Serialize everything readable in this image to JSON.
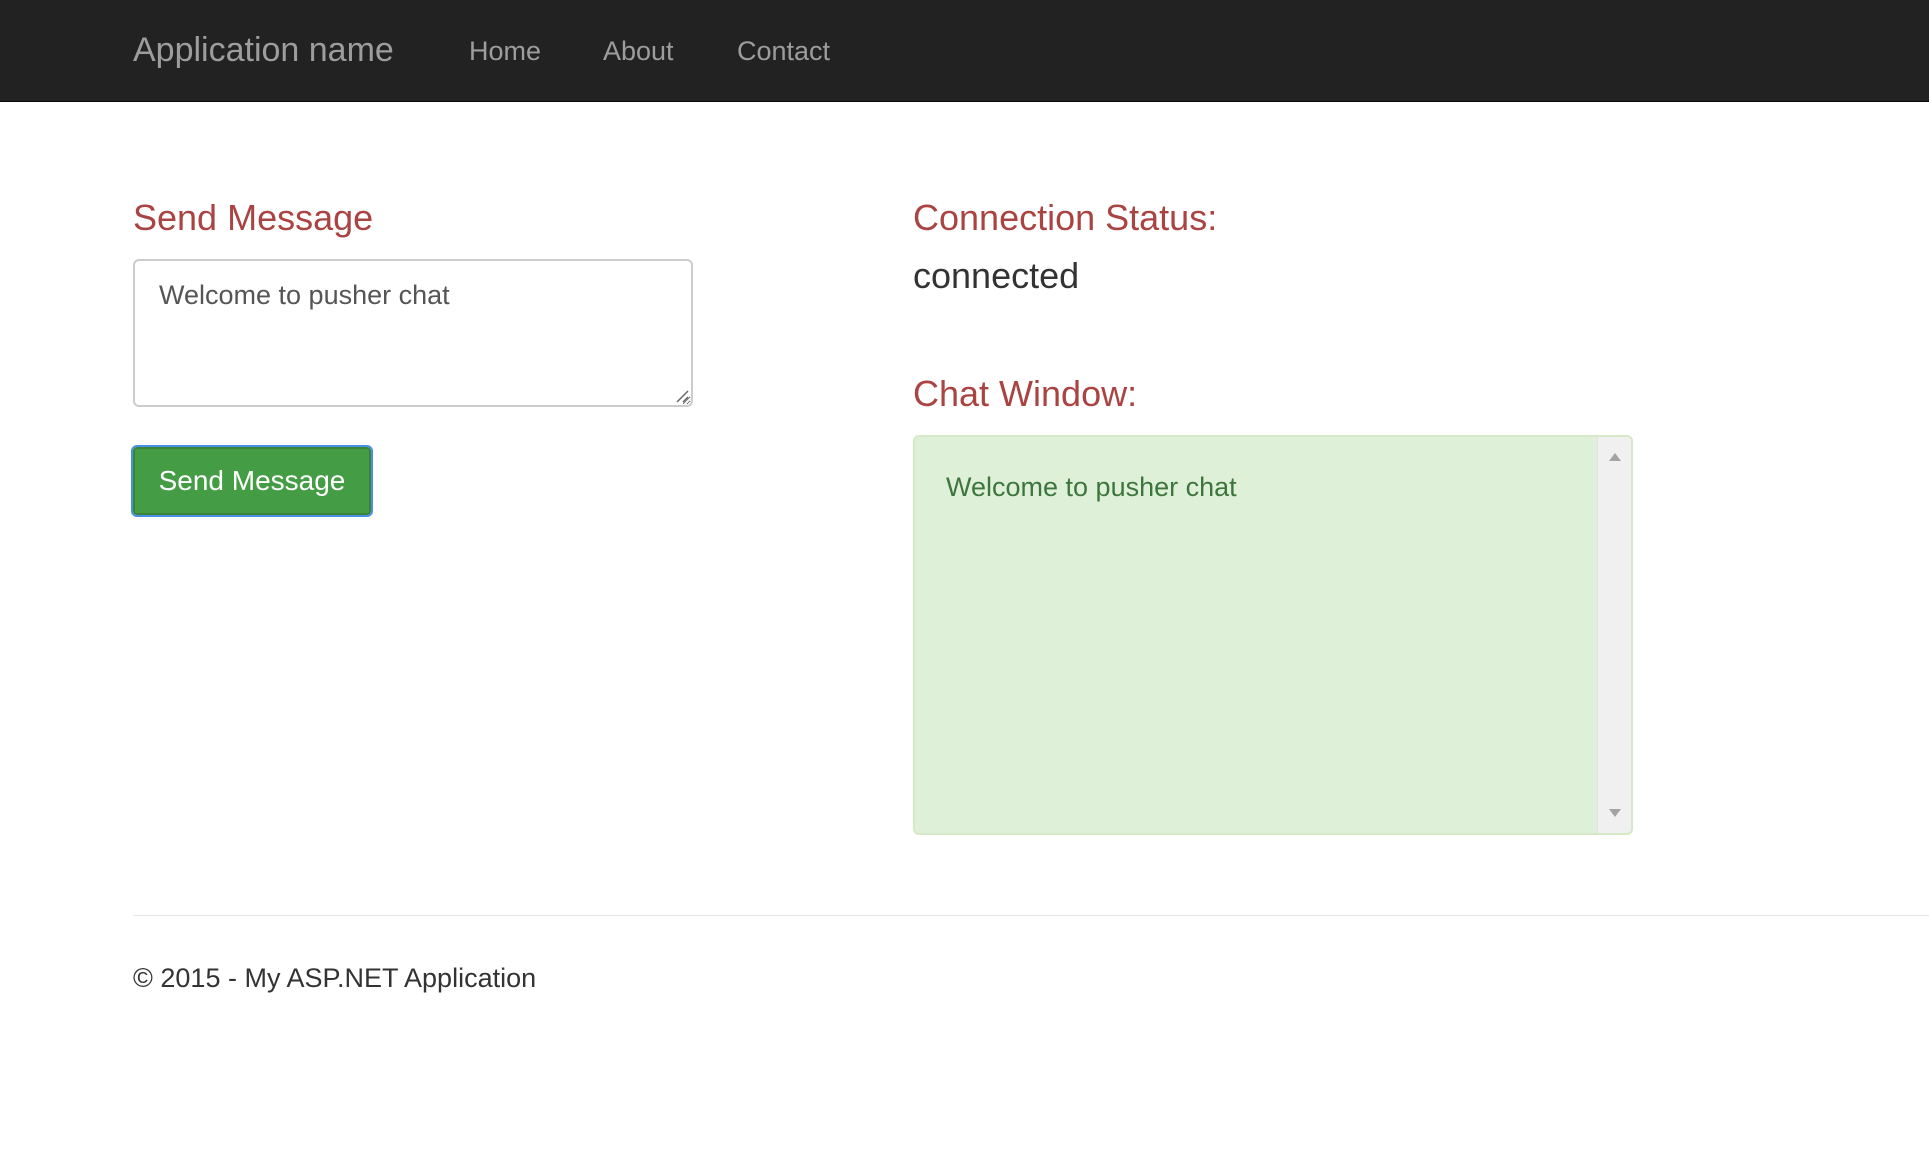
{
  "navbar": {
    "brand": "Application name",
    "links": [
      {
        "label": "Home"
      },
      {
        "label": "About"
      },
      {
        "label": "Contact"
      }
    ]
  },
  "send_section": {
    "heading": "Send Message",
    "message_value": "Welcome to pusher chat",
    "button_label": "Send Message"
  },
  "status_section": {
    "heading": "Connection Status:",
    "value": "connected"
  },
  "chat_section": {
    "heading": "Chat Window:",
    "messages": [
      "Welcome to pusher chat"
    ]
  },
  "footer": {
    "text": "© 2015 - My ASP.NET Application"
  },
  "colors": {
    "navbar_bg": "#222222",
    "nav_text": "#9d9d9d",
    "heading_red": "#a94442",
    "button_green": "#449d44",
    "chat_bg": "#dff0d8",
    "chat_text": "#3c763d"
  }
}
